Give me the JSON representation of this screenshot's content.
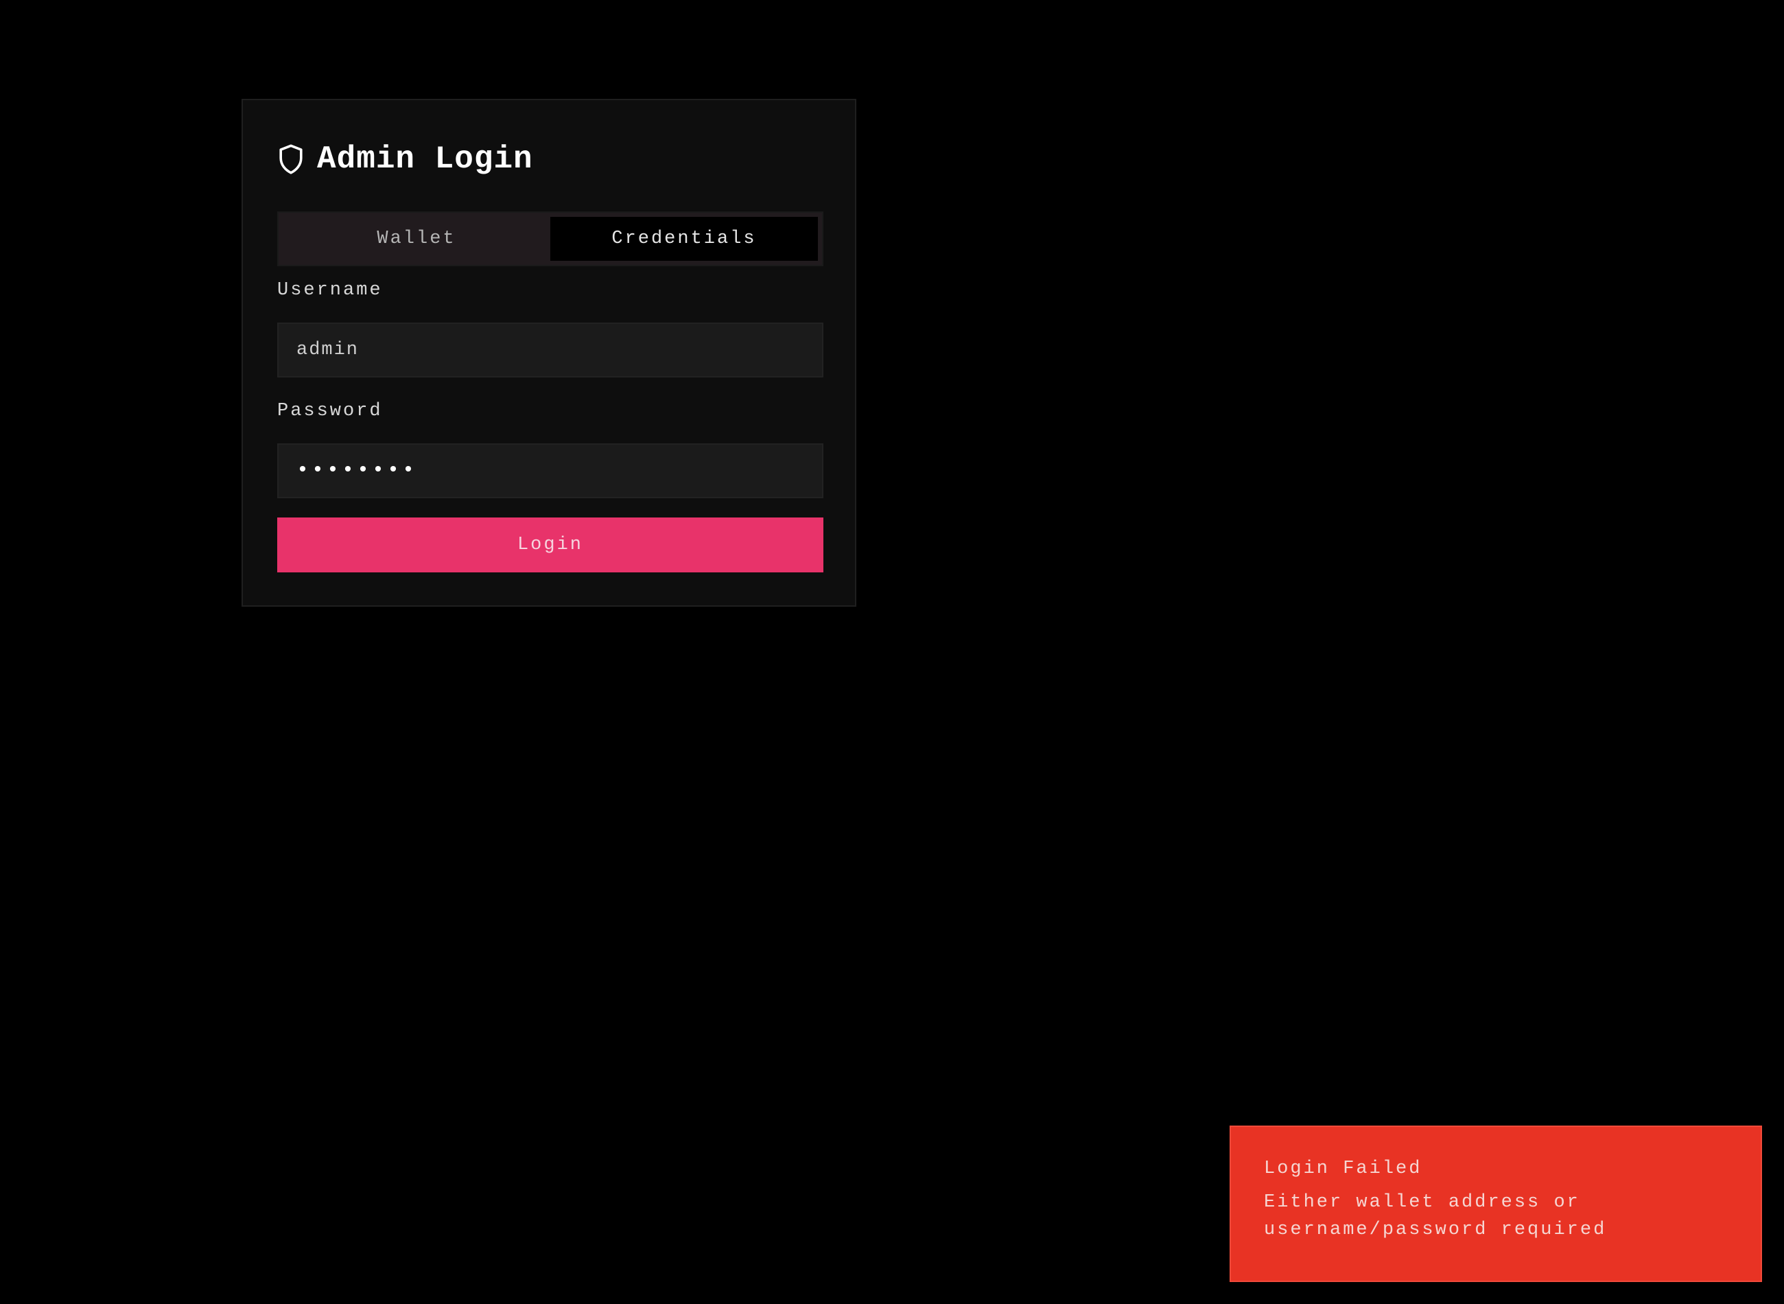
{
  "login_card": {
    "icon": "shield-icon",
    "title": "Admin Login",
    "tabs": [
      {
        "label": "Wallet",
        "active": false
      },
      {
        "label": "Credentials",
        "active": true
      }
    ],
    "username": {
      "label": "Username",
      "value": "admin"
    },
    "password": {
      "label": "Password",
      "value": "••••••••"
    },
    "login_button": "Login"
  },
  "toast": {
    "title": "Login Failed",
    "message": "Either wallet address or username/password required"
  },
  "colors": {
    "background": "#000000",
    "card": "#0e0e0e",
    "accent": "#e8336a",
    "error": "#e83324"
  }
}
